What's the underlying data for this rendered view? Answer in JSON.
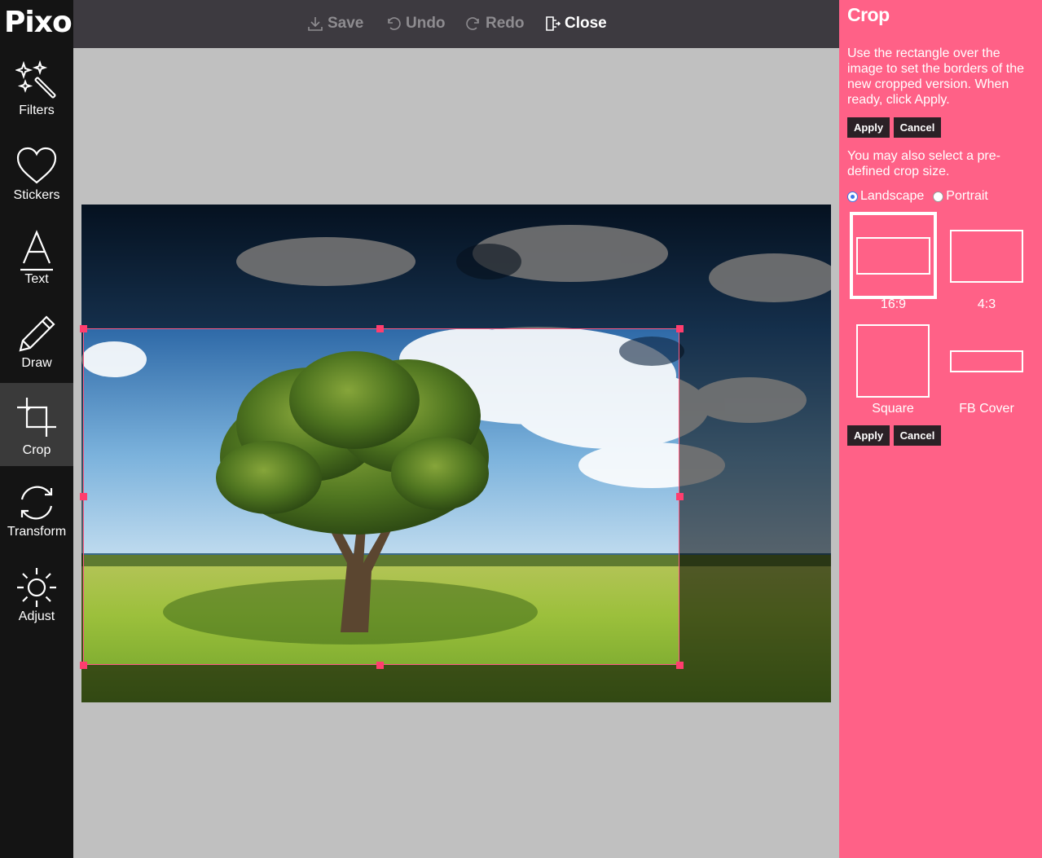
{
  "app": {
    "logo": "Pixo"
  },
  "sidebar": {
    "tools": [
      {
        "label": "Filters",
        "icon": "magic-wand-icon"
      },
      {
        "label": "Stickers",
        "icon": "heart-icon"
      },
      {
        "label": "Text",
        "icon": "text-a-icon"
      },
      {
        "label": "Draw",
        "icon": "pencil-icon"
      },
      {
        "label": "Crop",
        "icon": "crop-icon",
        "active": true
      },
      {
        "label": "Transform",
        "icon": "rotate-icon"
      },
      {
        "label": "Adjust",
        "icon": "sun-icon"
      }
    ]
  },
  "toolbar": {
    "save_label": "Save",
    "undo_label": "Undo",
    "redo_label": "Redo",
    "close_label": "Close"
  },
  "panel": {
    "title": "Crop",
    "instructions": "Use the rectangle over the image to set the borders of the new cropped version. When ready, click Apply.",
    "apply_label": "Apply",
    "cancel_label": "Cancel",
    "predefined_text": "You may also select a pre-defined crop size.",
    "orientation": {
      "landscape_label": "Landscape",
      "portrait_label": "Portrait",
      "selected": "Landscape"
    },
    "presets": [
      {
        "label": "16:9",
        "selected": true
      },
      {
        "label": "4:3"
      },
      {
        "label": "Square"
      },
      {
        "label": "FB Cover"
      }
    ]
  },
  "colors": {
    "panel_bg": "#ff6187",
    "sidebar_bg": "#141414",
    "toolbar_bg": "#3d3a40",
    "handle": "#ff3d6e",
    "button_bg": "#2b2126"
  }
}
